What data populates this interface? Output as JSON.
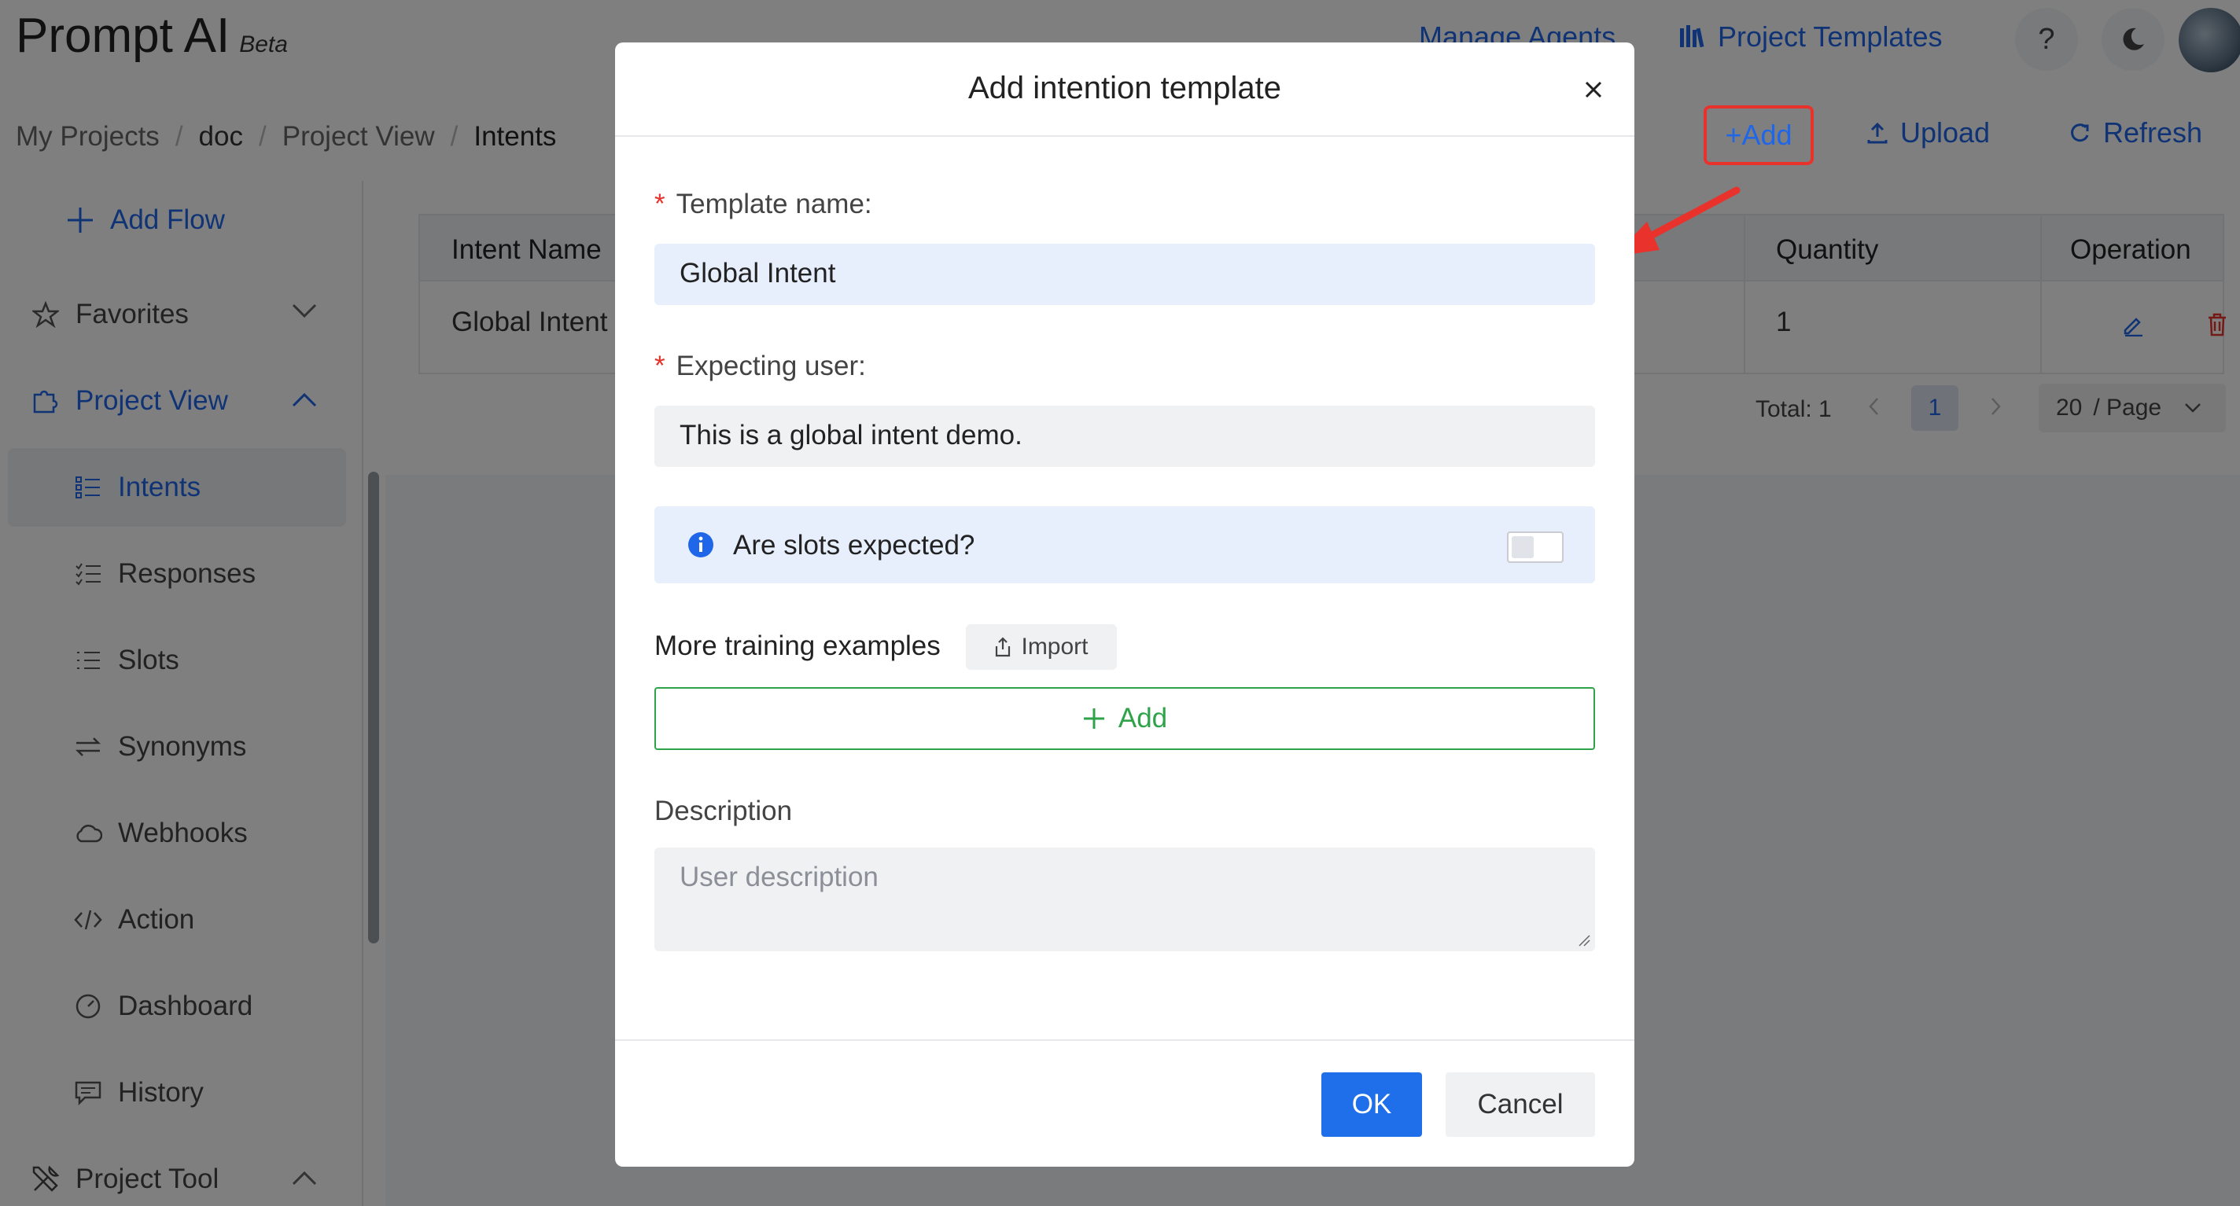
{
  "header": {
    "logo": "Prompt AI",
    "beta": "Beta",
    "manage_agents": "Manage Agents",
    "project_templates": "Project Templates",
    "help_icon": "question-icon",
    "theme_icon": "moon-icon"
  },
  "breadcrumb": [
    "My Projects",
    "doc",
    "Project View",
    "Intents"
  ],
  "toolbar": {
    "add": "+Add",
    "upload": "Upload",
    "refresh": "Refresh"
  },
  "sidebar": {
    "add_flow": "Add Flow",
    "favorites": "Favorites",
    "project_view": "Project View",
    "items": [
      "Intents",
      "Responses",
      "Slots",
      "Synonyms",
      "Webhooks",
      "Action",
      "Dashboard",
      "History"
    ],
    "project_tool": "Project Tool"
  },
  "table": {
    "headers": {
      "intent_name": "Intent Name",
      "quantity": "Quantity",
      "operation": "Operation"
    },
    "rows": [
      {
        "intent_name": "Global Intent",
        "quantity": "1"
      }
    ]
  },
  "pagination": {
    "total": "Total: 1",
    "page": "1",
    "page_size": "20",
    "per_page": "/ Page"
  },
  "modal": {
    "title": "Add intention template",
    "template_name_label": "Template name:",
    "template_name_value": "Global Intent",
    "expecting_user_label": "Expecting user:",
    "expecting_user_value": "This is a global intent demo.",
    "slots_question": "Are slots expected?",
    "more_examples": "More training examples",
    "import": "Import",
    "add": "Add",
    "description_label": "Description",
    "description_placeholder": "User description",
    "ok": "OK",
    "cancel": "Cancel"
  },
  "colors": {
    "primary": "#1f66e8",
    "danger": "#e8322b",
    "success": "#2ea34a",
    "ok_button": "#1f6feb"
  }
}
